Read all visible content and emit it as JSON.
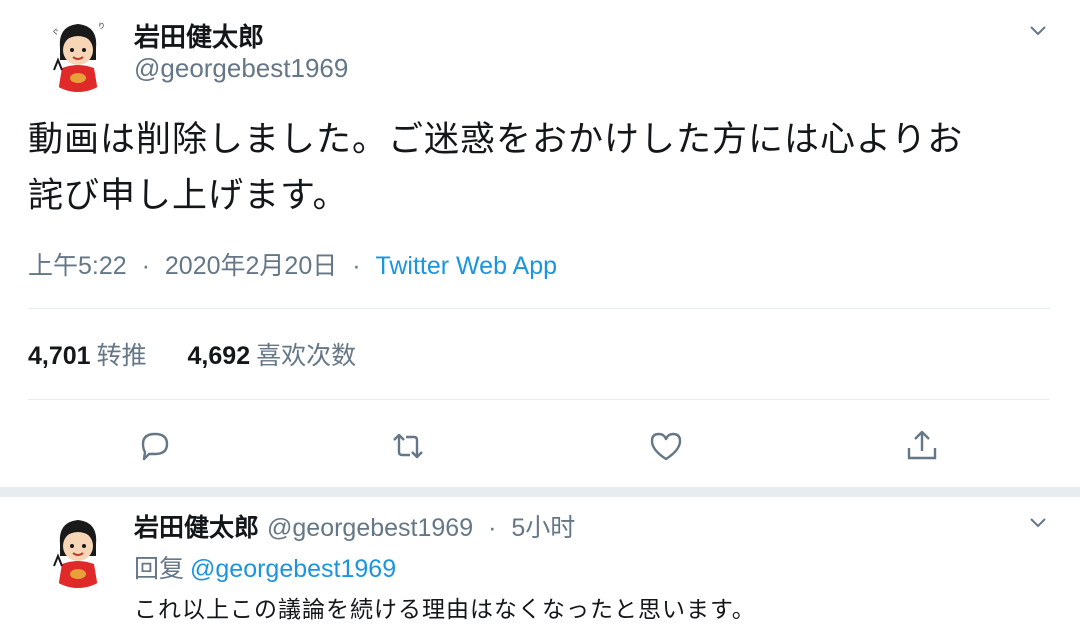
{
  "tweet": {
    "display_name": "岩田健太郎",
    "handle": "@georgebest1969",
    "text_line1": "動画は削除しました。ご迷惑をおかけした方には心よりお",
    "text_line2": "詫び申し上げます。",
    "time": "上午5:22",
    "dot1": "·",
    "date": "2020年2月20日",
    "dot2": "·",
    "app": "Twitter Web App",
    "retweets_count": "4,701",
    "retweets_label": "转推",
    "likes_count": "4,692",
    "likes_label": "喜欢次数",
    "icons": [
      "reply-icon",
      "retweet-icon",
      "like-icon",
      "share-icon",
      "chevron-down-icon"
    ]
  },
  "reply": {
    "display_name": "岩田健太郎",
    "handle": "@georgebest1969",
    "dot": "·",
    "time": "5小时",
    "replying_label": "回复",
    "replying_to": "@georgebest1969",
    "text": "これ以上この議論を続ける理由はなくなったと思います。"
  },
  "colors": {
    "text": "#14171a",
    "secondary": "#657786",
    "link": "#1b95e0",
    "divider": "#e6ecf0"
  }
}
